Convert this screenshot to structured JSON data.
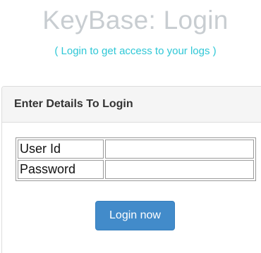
{
  "header": {
    "title": "KeyBase: Login",
    "subtitle": "( Login to get access to your logs )"
  },
  "panel": {
    "heading": "Enter Details To Login"
  },
  "form": {
    "userid_label": "User Id",
    "userid_value": "",
    "password_label": "Password",
    "password_value": "",
    "submit_label": "Login now"
  },
  "colors": {
    "title": "#c8cdd1",
    "subtitle": "#2ec7d6",
    "button": "#428bca",
    "panel_heading_bg": "#f5f5f5"
  }
}
